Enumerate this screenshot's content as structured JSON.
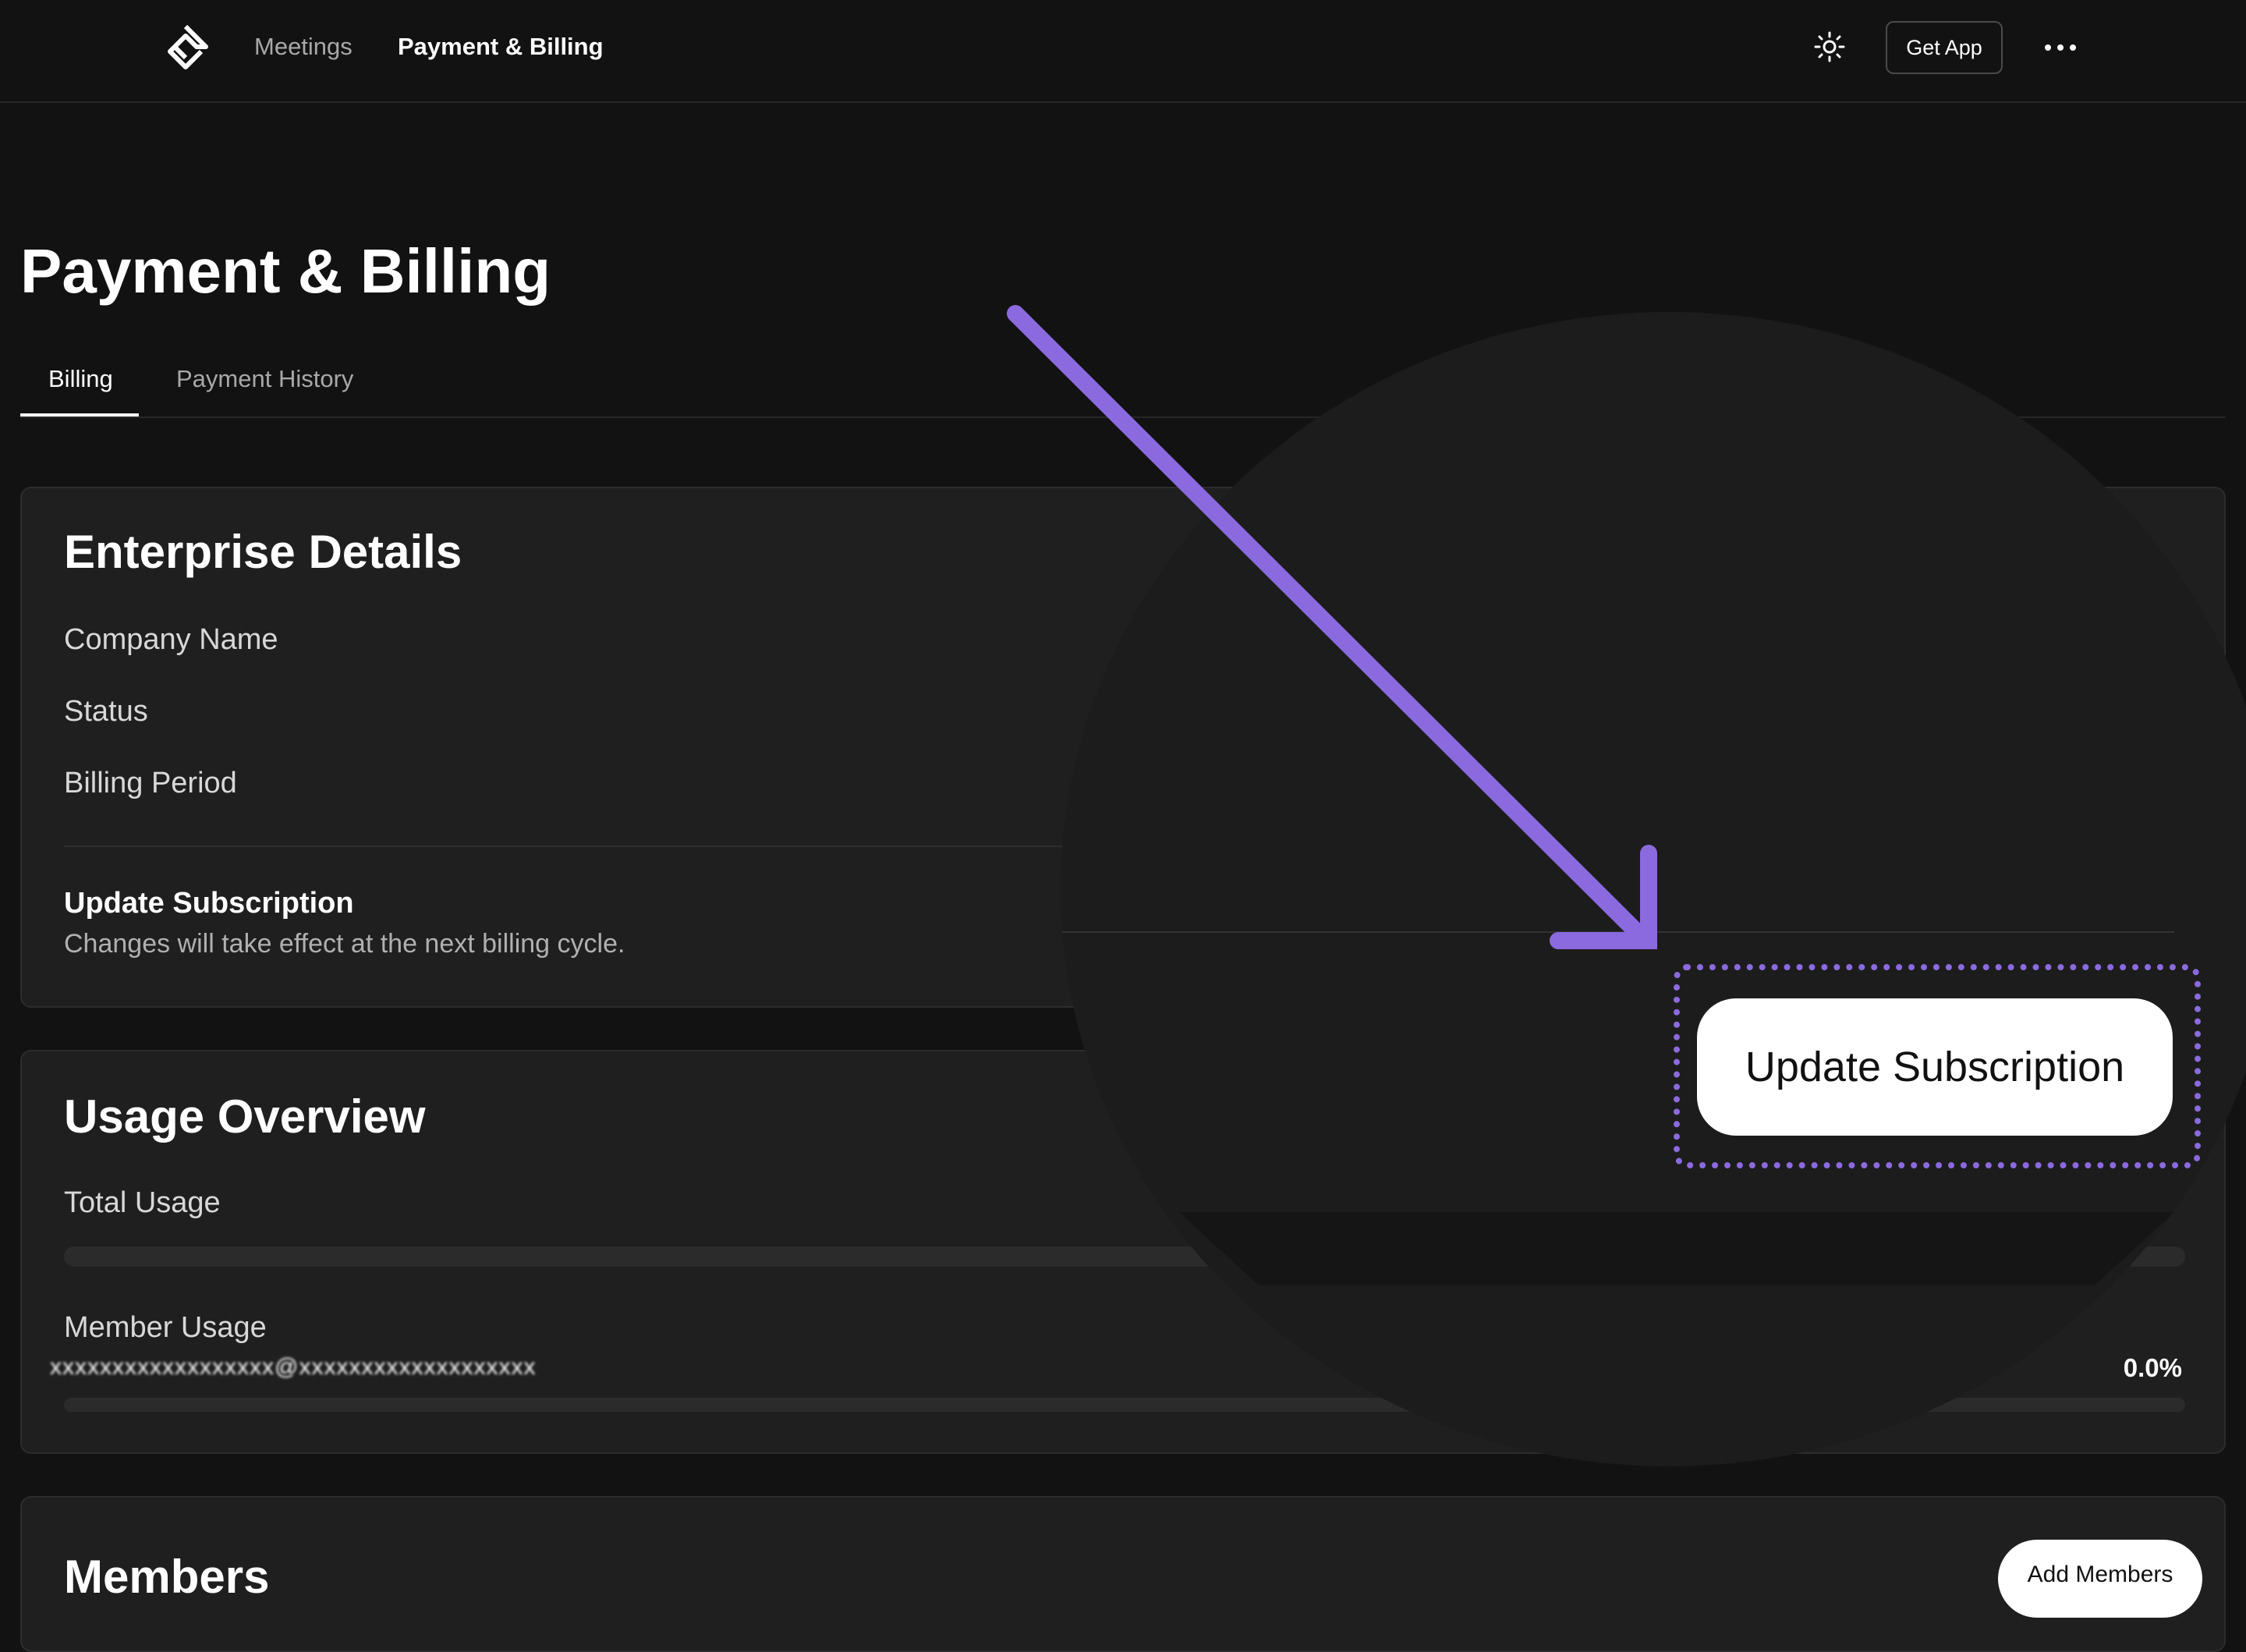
{
  "nav": {
    "meetings": "Meetings",
    "payment_billing": "Payment & Billing",
    "get_app": "Get App"
  },
  "page": {
    "title": "Payment & Billing",
    "tabs": [
      "Billing",
      "Payment History"
    ],
    "active_tab": "Billing"
  },
  "enterprise": {
    "title": "Enterprise Details",
    "fields": [
      "Company Name",
      "Status",
      "Billing Period"
    ],
    "update_title": "Update Subscription",
    "update_description": "Changes will take effect at the next billing cycle."
  },
  "usage": {
    "title": "Usage Overview",
    "total_label": "Total Usage",
    "member_label": "Member Usage",
    "member_email": "xxxxxxxxxxxxxxxxxx@xxxxxxxxxxxxxxxxxxx",
    "member_percent": "0.0%"
  },
  "members": {
    "title": "Members",
    "add_button": "Add Members"
  },
  "zoom": {
    "button_label": "Update Subscription"
  },
  "colors": {
    "background": "#121212",
    "card": "#1f1f1f",
    "accent_arrow": "#8b6adf"
  },
  "icons": [
    "logo-icon",
    "sun-icon",
    "more-icon"
  ]
}
